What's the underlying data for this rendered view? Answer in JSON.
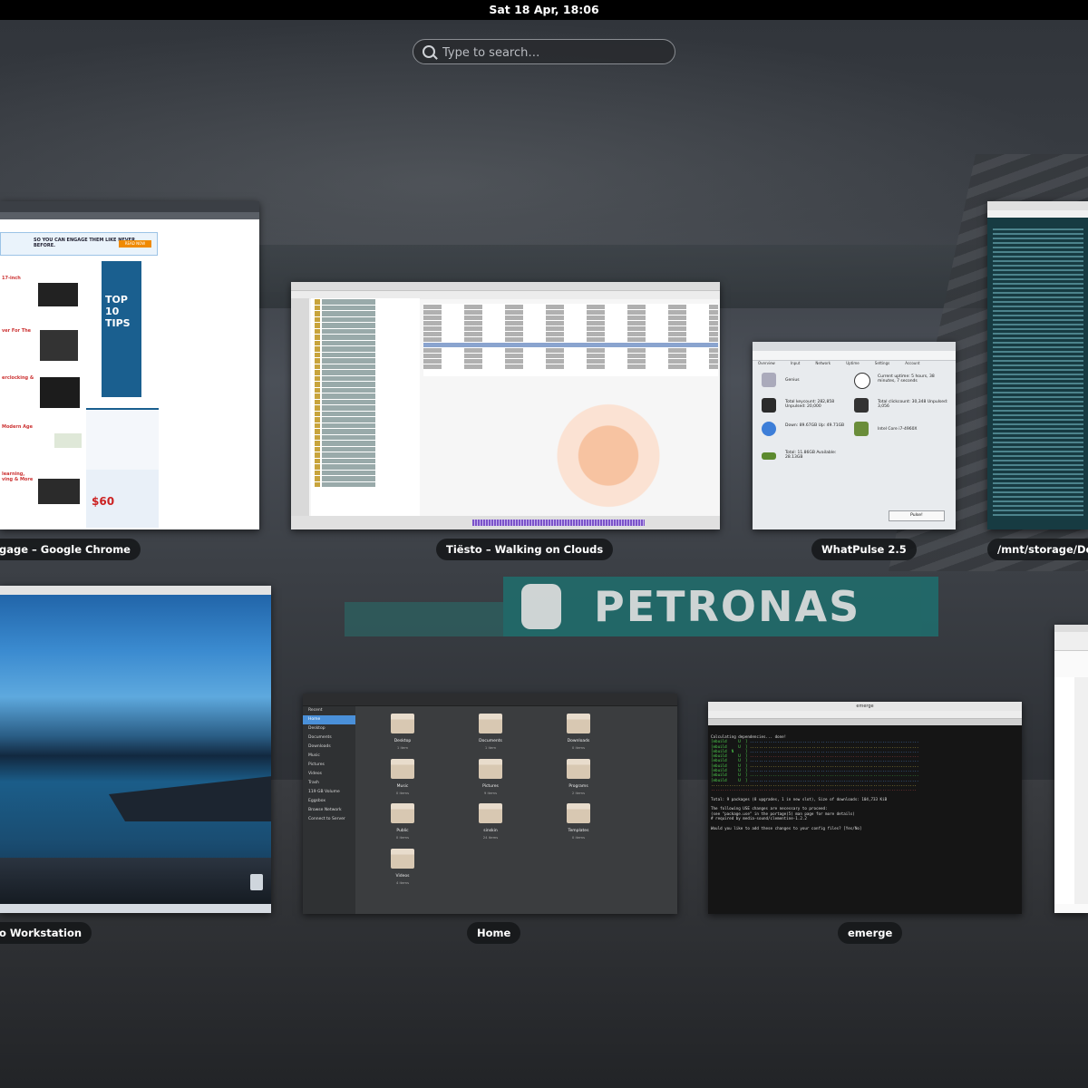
{
  "topbar": {
    "clock": "Sat 18 Apr, 18:06"
  },
  "search": {
    "placeholder": "Type to search…"
  },
  "windows": [
    {
      "caption": "gage – Google Chrome"
    },
    {
      "caption": "Tiësto – Walking on Clouds"
    },
    {
      "caption": "WhatPulse 2.5"
    },
    {
      "caption": "/mnt/storage/Docume"
    },
    {
      "caption": "o Workstation"
    },
    {
      "caption": "Home"
    },
    {
      "caption": "emerge"
    }
  ],
  "chrome_content": {
    "banner_text": "SO YOU CAN ENGAGE THEM LIKE NEVER BEFORE.",
    "banner_button": "READ NOW",
    "side_headline": "TOP 10 TIPS",
    "price": "$60",
    "headings": [
      "17-inch",
      "ver For The",
      "erclocking &",
      "Modern Age",
      "learning, ving & More"
    ]
  },
  "whatpulse_content": {
    "tabs": [
      "Overview",
      "Input",
      "Network",
      "Uptime",
      "Settings",
      "Account"
    ],
    "stats": [
      "Genius",
      "Total keycount: 282,858  Unpulsed: 20,000",
      "Down: 89.67GB  Up: 49.71GB",
      "Total: 11.86GB  Available: 28.13GB"
    ],
    "uptime": "Current uptime: 5 hours, 38 minutes, 7 seconds",
    "clicks": "Total clickcount: 30,348  Unpulsed: 3,056",
    "cpu": "Intel Core i7-4960X",
    "pulse_button": "Pulse!"
  },
  "home_content": {
    "sidebar": [
      "Recent",
      "Home",
      "Desktop",
      "Documents",
      "Downloads",
      "Music",
      "Pictures",
      "Videos",
      "Trash",
      "119 GB Volume",
      "Eggsbox",
      "Browse Network",
      "Connect to Server"
    ],
    "active_sidebar": "Home",
    "folders": [
      {
        "name": "Desktop",
        "count": "1 item"
      },
      {
        "name": "Documents",
        "count": "1 item"
      },
      {
        "name": "Downloads",
        "count": "0 items"
      },
      {
        "name": "Music",
        "count": "0 items"
      },
      {
        "name": "Pictures",
        "count": "9 items"
      },
      {
        "name": "Programs",
        "count": "2 items"
      },
      {
        "name": "Public",
        "count": "0 items"
      },
      {
        "name": "sinskin",
        "count": "24 items"
      },
      {
        "name": "Templates",
        "count": "0 items"
      },
      {
        "name": "Videos",
        "count": "4 items"
      }
    ]
  },
  "emerge_content": {
    "title": "emerge",
    "line_first": "Calculating dependencies... done!",
    "line_total": "Total: 9 packages (8 upgrades, 1 in new slot), Size of downloads: 104,733 KiB",
    "line_changes": "The following USE changes are necessary to proceed:",
    "line_changes_2": "(see \"package.use\" in the portage(5) man page for more details)",
    "line_req": "# required by media-sound/clementine-1.2.2",
    "line_prompt": "Would you like to add these changes to your config files? [Yes/No]"
  },
  "colors": {
    "topbar": "#000000",
    "selection": "#4a90d9",
    "caption_bg": "#141619"
  }
}
